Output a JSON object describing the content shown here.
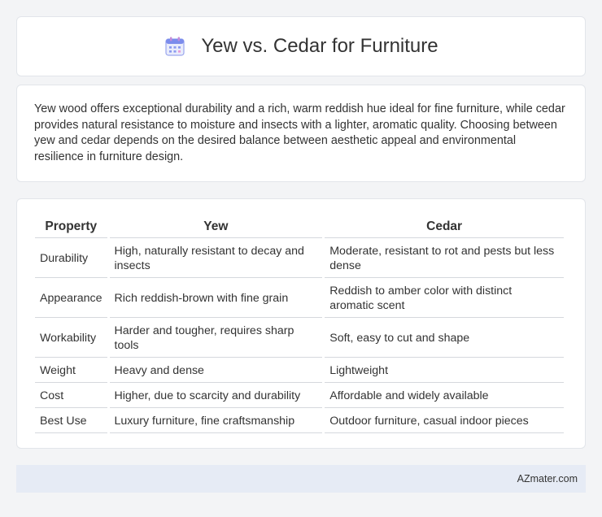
{
  "header": {
    "icon": "calendar-icon",
    "title": "Yew vs. Cedar for Furniture"
  },
  "intro": {
    "text": "Yew wood offers exceptional durability and a rich, warm reddish hue ideal for fine furniture, while cedar provides natural resistance to moisture and insects with a lighter, aromatic quality. Choosing between yew and cedar depends on the desired balance between aesthetic appeal and environmental resilience in furniture design."
  },
  "table": {
    "headers": [
      "Property",
      "Yew",
      "Cedar"
    ],
    "rows": [
      [
        "Durability",
        "High, naturally resistant to decay and insects",
        "Moderate, resistant to rot and pests but less dense"
      ],
      [
        "Appearance",
        "Rich reddish-brown with fine grain",
        "Reddish to amber color with distinct aromatic scent"
      ],
      [
        "Workability",
        "Harder and tougher, requires sharp tools",
        "Soft, easy to cut and shape"
      ],
      [
        "Weight",
        "Heavy and dense",
        "Lightweight"
      ],
      [
        "Cost",
        "Higher, due to scarcity and durability",
        "Affordable and widely available"
      ],
      [
        "Best Use",
        "Luxury furniture, fine craftsmanship",
        "Outdoor furniture, casual indoor pieces"
      ]
    ]
  },
  "footer": {
    "text": "AZmater.com"
  },
  "colors": {
    "background": "#f3f4f6",
    "card": "#ffffff",
    "footer_bg": "#e6ebf5",
    "icon_accent": "#6b7ee8"
  }
}
